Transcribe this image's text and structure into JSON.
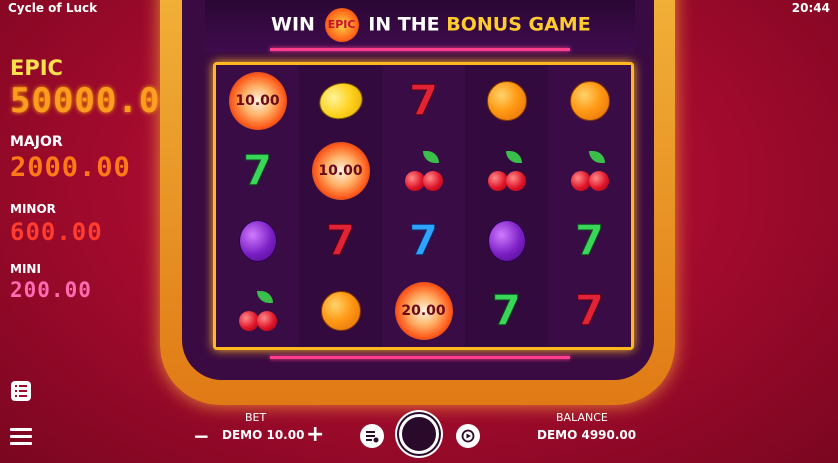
{
  "status_bar": {
    "app_title": "Cycle of Luck",
    "time": "20:44"
  },
  "jackpots": {
    "epic": {
      "label": "EPIC",
      "value": "50000.00"
    },
    "major": {
      "label": "MAJOR",
      "value": "2000.00"
    },
    "minor": {
      "label": "MINOR",
      "value": "600.00"
    },
    "mini": {
      "label": "MINI",
      "value": "200.00"
    }
  },
  "banner": {
    "win": "WIN",
    "badge": "EPIC",
    "in_the": "IN THE",
    "bonus_game": "BONUS GAME"
  },
  "reels": {
    "rows": [
      [
        "coin:10.00",
        "lemon",
        "seven-red",
        "orange",
        "orange"
      ],
      [
        "seven-green",
        "coin:10.00",
        "cherry",
        "cherry",
        "cherry"
      ],
      [
        "plum",
        "seven-red",
        "seven-blue",
        "plum",
        "seven-green"
      ],
      [
        "cherry",
        "orange",
        "coin:20.00",
        "seven-green",
        "seven-red"
      ]
    ]
  },
  "controls": {
    "bet_label": "BET",
    "bet_value": "DEMO 10.00",
    "minus": "−",
    "plus": "+",
    "balance_label": "BALANCE",
    "balance_value": "DEMO 4990.00"
  },
  "colors": {
    "accent": "#ffb81f",
    "background": "#b00d33",
    "reel_bg": "#360b3f"
  }
}
